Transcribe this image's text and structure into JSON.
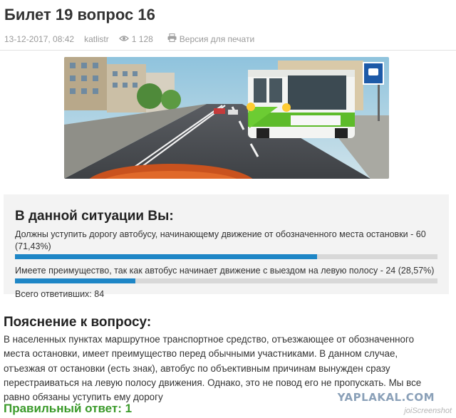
{
  "article": {
    "title": "Билет 19 вопрос 16",
    "date": "13-12-2017, 08:42",
    "author": "katlistr",
    "views": "1 128",
    "print_label": "Версия для печати"
  },
  "poll": {
    "question": "В данной ситуации Вы:",
    "options": [
      {
        "text": "Должны уступить дорогу автобусу, начинающему движение от обозначенного места остановки - 60 (71,43%)",
        "percent": 71.43,
        "color": "#1e86c6"
      },
      {
        "text": "Имеете преимущество, так как автобус начинает движение с выездом на левую полосу - 24 (28,57%)",
        "percent": 28.57,
        "color": "#1e86c6"
      }
    ],
    "total": "Всего ответивших: 84"
  },
  "explanation": {
    "title": "Пояснение к вопросу:",
    "text": "В населенных пунктах маршрутное транспортное средство, отъезжающее от обозначенного места остановки, имеет преимущество перед обычными участниками. В данном случае, отъезжая от остановки (есть знак), автобус по объективным причинам вынужден сразу перестраиваться на левую полосу движения. Однако, это не повод его не пропускать. Мы все равно обязаны уступить ему дорогу"
  },
  "answer": "Правильный ответ: 1",
  "watermark": {
    "main": "YAPLAKAL.COM",
    "sub": "joiScreenshot"
  },
  "icons": {
    "views": "eye-icon",
    "print": "printer-icon"
  }
}
